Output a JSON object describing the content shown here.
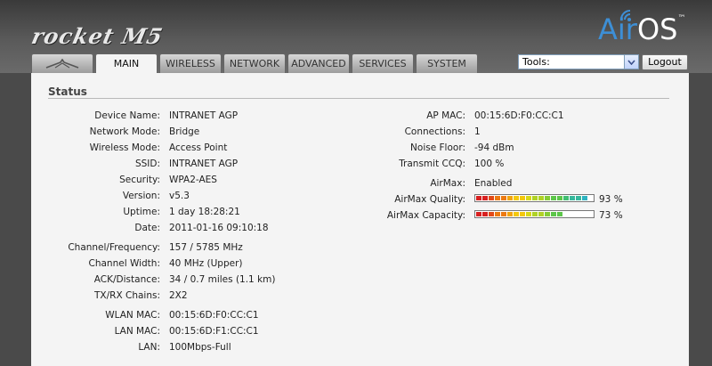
{
  "header": {
    "brand_left": "rocket M5",
    "brand_right_air": "Air",
    "brand_right_os": "OS",
    "brand_right_tm": "™"
  },
  "tabs": [
    {
      "label": "MAIN",
      "active": true
    },
    {
      "label": "WIRELESS",
      "active": false
    },
    {
      "label": "NETWORK",
      "active": false
    },
    {
      "label": "ADVANCED",
      "active": false
    },
    {
      "label": "SERVICES",
      "active": false
    },
    {
      "label": "SYSTEM",
      "active": false
    }
  ],
  "toolbar": {
    "tools_value": "Tools:",
    "logout_label": "Logout"
  },
  "status": {
    "title": "Status",
    "left": [
      {
        "label": "Device Name:",
        "value": "INTRANET AGP"
      },
      {
        "label": "Network Mode:",
        "value": "Bridge"
      },
      {
        "label": "Wireless Mode:",
        "value": "Access Point"
      },
      {
        "label": "SSID:",
        "value": "INTRANET AGP"
      },
      {
        "label": "Security:",
        "value": "WPA2-AES"
      },
      {
        "label": "Version:",
        "value": "v5.3"
      },
      {
        "label": "Uptime:",
        "value": "1 day 18:28:21"
      },
      {
        "label": "Date:",
        "value": "2011-01-16 09:10:18"
      },
      {
        "label": "Channel/Frequency:",
        "value": "157 / 5785 MHz"
      },
      {
        "label": "Channel Width:",
        "value": "40 MHz (Upper)"
      },
      {
        "label": "ACK/Distance:",
        "value": "34 / 0.7 miles (1.1 km)"
      },
      {
        "label": "TX/RX Chains:",
        "value": "2X2"
      },
      {
        "label": "WLAN MAC:",
        "value": "00:15:6D:F0:CC:C1"
      },
      {
        "label": "LAN MAC:",
        "value": "00:15:6D:F1:CC:C1"
      },
      {
        "label": "LAN:",
        "value": "100Mbps-Full"
      }
    ],
    "right": [
      {
        "label": "AP MAC:",
        "value": "00:15:6D:F0:CC:C1"
      },
      {
        "label": "Connections:",
        "value": "1"
      },
      {
        "label": "Noise Floor:",
        "value": "-94 dBm"
      },
      {
        "label": "Transmit CCQ:",
        "value": "100 %"
      },
      {
        "label": "AirMax:",
        "value": "Enabled"
      }
    ],
    "airmax_quality": {
      "label": "AirMax Quality:",
      "percent": 93,
      "text": "93 %"
    },
    "airmax_capacity": {
      "label": "AirMax Capacity:",
      "percent": 73,
      "text": "73 %"
    }
  },
  "colors": {
    "bar_segments": [
      "#d82020",
      "#e24a18",
      "#ec7a12",
      "#f2a40e",
      "#f4c80c",
      "#d8d818",
      "#b0d226",
      "#86cc36",
      "#5cc64a",
      "#40be72",
      "#36b89c",
      "#2eb2c0",
      "#2ca8d2"
    ]
  }
}
